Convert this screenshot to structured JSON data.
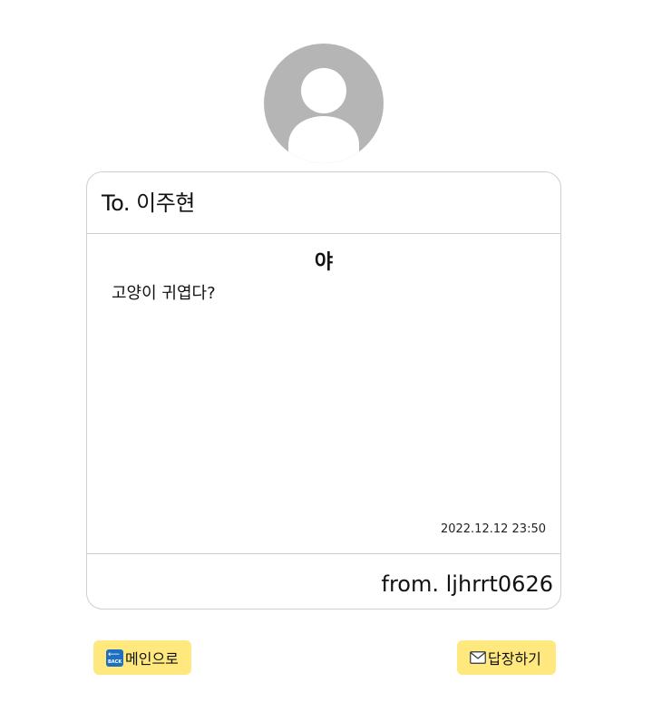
{
  "recipient": {
    "prefix": "To.",
    "name": "이주현"
  },
  "message": {
    "title": "야",
    "body": "고양이 귀엽다?",
    "datetime": "2022.12.12 23:50"
  },
  "sender": {
    "prefix": "from.",
    "username": "ljhrrt0626"
  },
  "buttons": {
    "main_label": "메인으로",
    "main_icon": "back-icon",
    "main_icon_text": "BACK",
    "reply_label": "답장하기",
    "reply_icon": "envelope-icon"
  },
  "colors": {
    "button_bg": "#ffe97f",
    "avatar": "#b5b5b5",
    "border": "#cfcfcf"
  }
}
